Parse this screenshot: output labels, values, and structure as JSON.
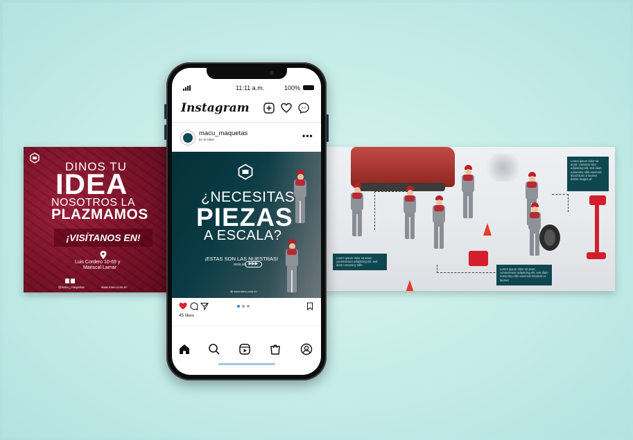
{
  "left_post": {
    "line1": "DINOS TU",
    "line2": "IDEA",
    "line3": "NOSOTROS LA",
    "line4": "PLAZMAMOS",
    "cta": "¡VISÍTANOS EN!",
    "address_line1": "Luis Cordero 10-69 y",
    "address_line2": "Mariscal Lamar",
    "instagram_handle": "@macu_maquetas",
    "website": "www.macu.com.ec"
  },
  "phone": {
    "status_bar": {
      "time": "11:11 a.m.",
      "battery": "100%"
    },
    "app_name": "Instagram",
    "post": {
      "username": "macu_maquetas",
      "location": "En el Taller",
      "more": "•••",
      "headline1": "¿NECESITAS",
      "headline2": "PIEZAS",
      "headline3": "A ESCALA?",
      "subline": "¡ESTAS SON LAS NUESTRAS!",
      "swipe_label": "DESLIZA",
      "swipe_arrows": "▶▶▶",
      "website": "@ www.macu.com.ec",
      "likes": "45 likes"
    }
  },
  "right_post": {
    "note_top_right": "Lorem ipsum dolor sit amet, consecte-tuer adipiscing elit, sed diam nonummy nibh euismod tincid-dunt ut laoreet dolore magna al-",
    "note_left": "Lorem ipsum dolor sit amet, consectetuer adipiscing elit, sed diam nonummy nibh",
    "note_bottom_right": "Lorem ipsum dolor sit amet, consectetuer adipiscing elit, sed diam nonummy nibh euismod tincidunt ut laoreet"
  },
  "colors": {
    "background": "#c3ebe7",
    "left_post_red": "#7a1229",
    "post_teal": "#0a3c45",
    "note_teal": "#0f4750",
    "like_red": "#d9262d"
  }
}
